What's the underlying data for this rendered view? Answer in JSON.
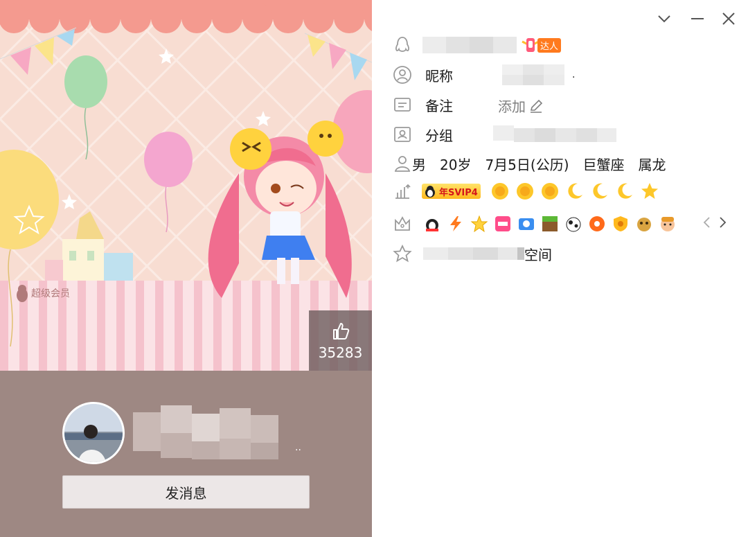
{
  "cover": {
    "vip_mark": "超级会员",
    "likes": "35283"
  },
  "card": {
    "name_suffix": "..",
    "send_button": "发消息"
  },
  "profile": {
    "expert_badge": "达人",
    "nickname_label": "昵称",
    "nickname_suffix": ".",
    "remark_label": "备注",
    "remark_add": "添加",
    "group_label": "分组",
    "gender": "男",
    "age": "20岁",
    "birthday": "7月5日(公历)",
    "zodiac": "巨蟹座",
    "chinese_zodiac": "属龙",
    "svip_badge": "年SVIP4",
    "level_icons": [
      "sun-icon",
      "sun-icon",
      "sun-icon",
      "moon-icon",
      "moon-icon",
      "moon-icon",
      "star-icon"
    ],
    "space_label": "空间"
  },
  "colors": {
    "cover_bg": "#f8ddd2",
    "bottom_bg": "#9e8883",
    "send_button_bg": "#ece7e7",
    "expert_orange": "#ff7a1e",
    "icon_gray": "#9a9a9a"
  }
}
